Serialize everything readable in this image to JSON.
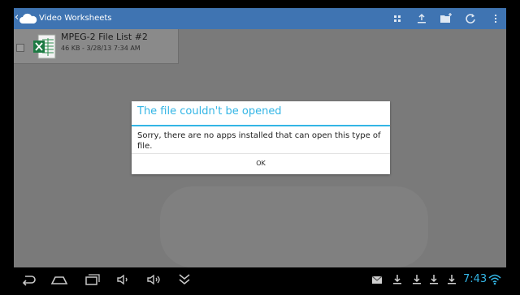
{
  "actionbar": {
    "title": "Video Worksheets",
    "color": "#3f74b2",
    "icons": [
      "grid-view-icon",
      "upload-icon",
      "new-folder-icon",
      "refresh-icon",
      "overflow-menu-icon"
    ]
  },
  "file": {
    "name": "MPEG-2 File List #2",
    "meta": "46 KB - 3/28/13 7:34 AM",
    "icon": "excel-file-icon"
  },
  "dialog": {
    "title": "The file couldn't be opened",
    "message": "Sorry, there are no apps installed that can open this type of file.",
    "ok_label": "OK",
    "accent_color": "#33b5e5"
  },
  "system_bar": {
    "time": "7:43",
    "nav_icons": [
      "back-icon",
      "home-icon",
      "recent-apps-icon",
      "volume-down-icon",
      "volume-up-icon",
      "hide-keyboard-icon"
    ],
    "status_icons": [
      "gmail-icon",
      "download-icon",
      "download-icon",
      "download-icon",
      "download-icon",
      "wifi-icon"
    ]
  }
}
